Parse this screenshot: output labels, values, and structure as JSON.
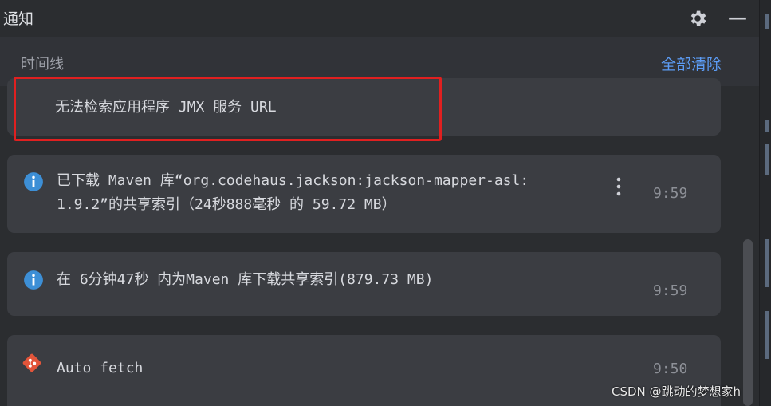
{
  "window": {
    "title": "通知"
  },
  "timeline": {
    "label": "时间线",
    "clear_all": "全部清除"
  },
  "notifications": [
    {
      "text": "无法检索应用程序 JMX 服务 URL"
    },
    {
      "icon": "info-icon",
      "line1": "已下载 Maven 库“org.codehaus.jackson:jackson-mapper-asl:",
      "line2": "1.9.2”的共享索引（24秒888毫秒 的 59.72 MB）",
      "time": "9:59"
    },
    {
      "icon": "info-icon",
      "text": "在 6分钟47秒 内为Maven 库下载共享索引(879.73 MB)",
      "time": "9:59"
    },
    {
      "icon": "git-icon",
      "text": "Auto fetch",
      "time": "9:50"
    }
  ],
  "watermark": "CSDN @跳动的梦想家h",
  "colors": {
    "accent": "#5c9cf5",
    "info": "#3d8fd6",
    "git": "#e2553a",
    "highlight": "#e02020"
  }
}
